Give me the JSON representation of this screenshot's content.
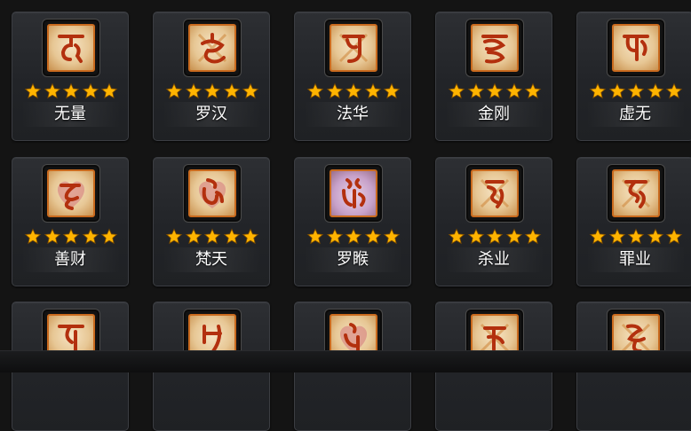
{
  "colors": {
    "star": "#ffb400",
    "frame_border": "#c96a1e",
    "card_bg": "#26282c",
    "text": "#ffffff"
  },
  "cards": [
    {
      "label": "无量",
      "stars": 5,
      "icon": "rune-icon",
      "tint": "#e8c894"
    },
    {
      "label": "罗汉",
      "stars": 5,
      "icon": "rune-icon",
      "tint": "#e8c894"
    },
    {
      "label": "法华",
      "stars": 5,
      "icon": "rune-icon",
      "tint": "#e8c894"
    },
    {
      "label": "金刚",
      "stars": 5,
      "icon": "rune-icon",
      "tint": "#e8c894"
    },
    {
      "label": "虚无",
      "stars": 5,
      "icon": "rune-icon",
      "tint": "#e8c894"
    },
    {
      "label": "善财",
      "stars": 5,
      "icon": "heart-rune-icon",
      "tint": "#e6a8a0"
    },
    {
      "label": "梵天",
      "stars": 5,
      "icon": "heart-rune-icon",
      "tint": "#e6a8a0"
    },
    {
      "label": "罗睺",
      "stars": 5,
      "icon": "rune-icon",
      "tint": "#c8a0d0"
    },
    {
      "label": "杀业",
      "stars": 5,
      "icon": "rune-icon",
      "tint": "#e8c894"
    },
    {
      "label": "罪业",
      "stars": 5,
      "icon": "rune-icon",
      "tint": "#e8c894"
    },
    {
      "label": "",
      "stars": 0,
      "icon": "rune-icon",
      "tint": "#e8c894"
    },
    {
      "label": "",
      "stars": 0,
      "icon": "rune-icon",
      "tint": "#e8c894"
    },
    {
      "label": "",
      "stars": 0,
      "icon": "heart-rune-icon",
      "tint": "#e6a8a0"
    },
    {
      "label": "",
      "stars": 0,
      "icon": "rune-icon",
      "tint": "#e8c894"
    },
    {
      "label": "",
      "stars": 0,
      "icon": "rune-icon",
      "tint": "#e8c894"
    }
  ]
}
